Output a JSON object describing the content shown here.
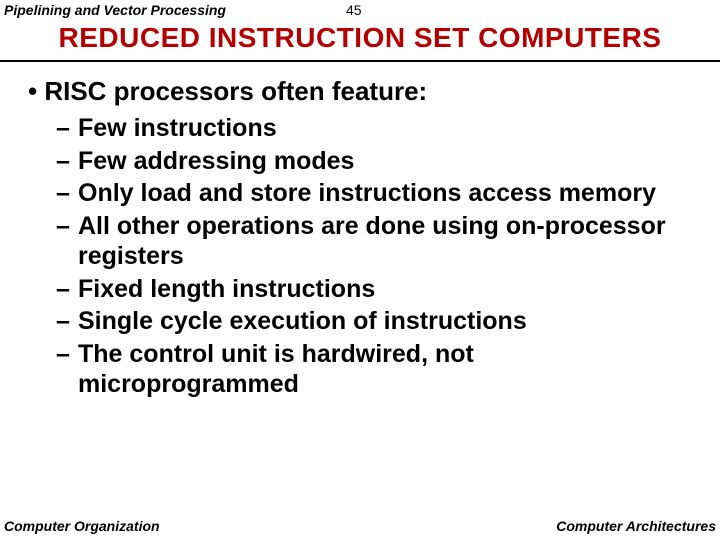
{
  "header": {
    "topic": "Pipelining and Vector Processing",
    "page_number": "45"
  },
  "title": "REDUCED INSTRUCTION SET COMPUTERS",
  "lead_bullet_prefix": "• ",
  "lead": "RISC processors often feature:",
  "items": [
    "Few instructions",
    "Few addressing modes",
    "Only load and store instructions access memory",
    "All other operations are done using on-processor registers",
    "Fixed length instructions",
    "Single cycle execution of instructions",
    "The control unit is hardwired, not microprogrammed"
  ],
  "footer": {
    "left": "Computer Organization",
    "right": "Computer Architectures"
  }
}
